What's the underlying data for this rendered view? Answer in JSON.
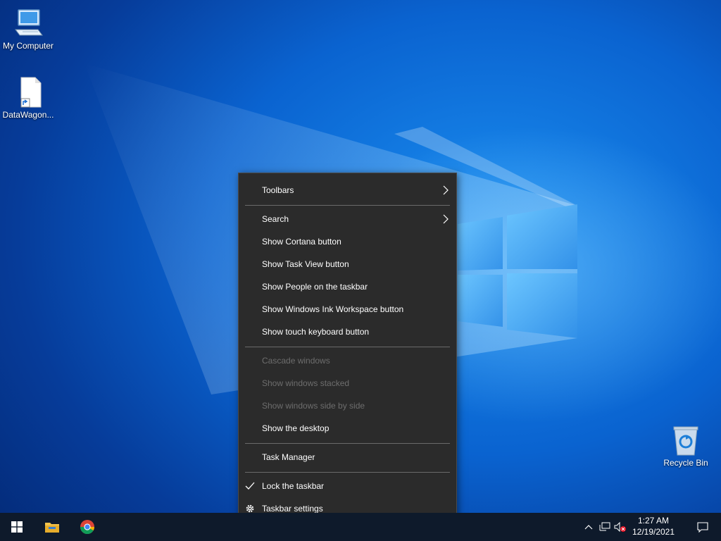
{
  "desktop": {
    "icons": [
      {
        "label": "My Computer",
        "icon": "computer-icon"
      },
      {
        "label": "DataWagon...",
        "icon": "file-shortcut-icon"
      },
      {
        "label": "Recycle Bin",
        "icon": "recycle-bin-icon"
      }
    ]
  },
  "context_menu": {
    "items": [
      {
        "label": "Toolbars",
        "submenu": true,
        "enabled": true
      },
      {
        "label": "Search",
        "submenu": true,
        "enabled": true
      },
      {
        "label": "Show Cortana button",
        "enabled": true
      },
      {
        "label": "Show Task View button",
        "enabled": true
      },
      {
        "label": "Show People on the taskbar",
        "enabled": true
      },
      {
        "label": "Show Windows Ink Workspace button",
        "enabled": true
      },
      {
        "label": "Show touch keyboard button",
        "enabled": true
      },
      {
        "label": "Cascade windows",
        "enabled": false
      },
      {
        "label": "Show windows stacked",
        "enabled": false
      },
      {
        "label": "Show windows side by side",
        "enabled": false
      },
      {
        "label": "Show the desktop",
        "enabled": true
      },
      {
        "label": "Task Manager",
        "enabled": true
      },
      {
        "label": "Lock the taskbar",
        "enabled": true,
        "checked": true
      },
      {
        "label": "Taskbar settings",
        "enabled": true,
        "icon": "gear-icon"
      }
    ]
  },
  "taskbar": {
    "buttons": [
      {
        "name": "start",
        "icon": "windows-logo-icon"
      },
      {
        "name": "file-explorer",
        "icon": "folder-icon"
      },
      {
        "name": "chrome",
        "icon": "chrome-icon"
      }
    ],
    "tray": {
      "icons": [
        "chevron-up-icon",
        "network-icon",
        "volume-muted-icon",
        "notification-icon"
      ],
      "time": "1:27 AM",
      "date": "12/19/2021"
    }
  },
  "colors": {
    "menu_bg": "#2b2b2b",
    "menu_text": "#ffffff",
    "menu_disabled": "#6d6d6d",
    "taskbar_bg": "#0e1a2b"
  }
}
